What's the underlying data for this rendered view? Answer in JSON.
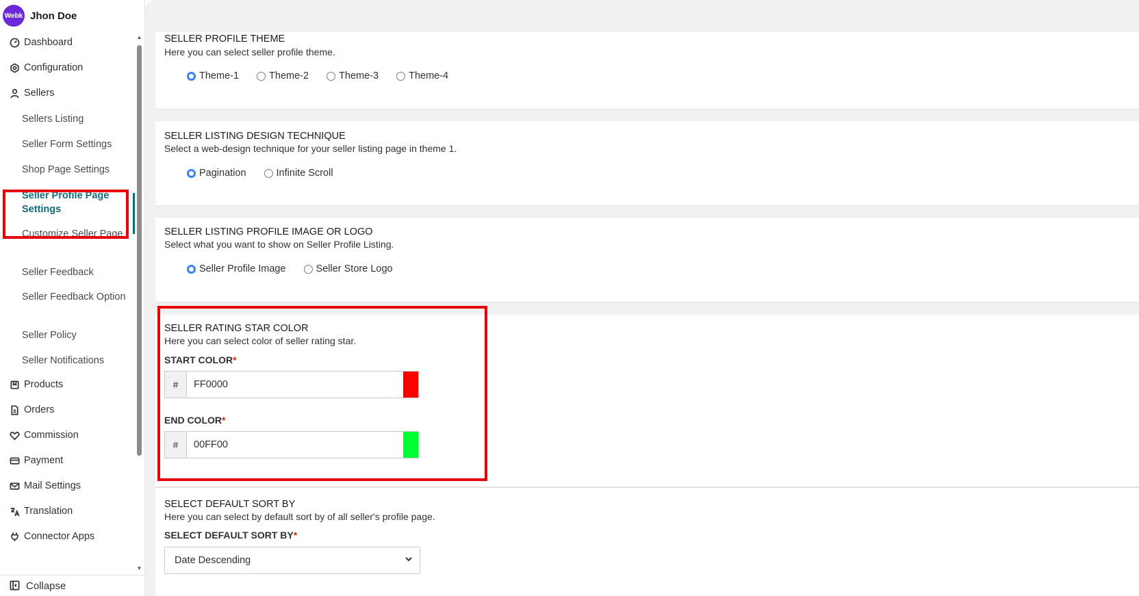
{
  "user": {
    "avatar_text": "Webk",
    "name": "Jhon Doe"
  },
  "sidebar": {
    "items": [
      {
        "label": "Dashboard",
        "icon": "dashboard-icon"
      },
      {
        "label": "Configuration",
        "icon": "gear-icon"
      },
      {
        "label": "Sellers",
        "icon": "person-icon"
      },
      {
        "label": "Products",
        "icon": "products-icon"
      },
      {
        "label": "Orders",
        "icon": "orders-icon"
      },
      {
        "label": "Commission",
        "icon": "commission-icon"
      },
      {
        "label": "Payment",
        "icon": "card-icon"
      },
      {
        "label": "Mail Settings",
        "icon": "mail-icon"
      },
      {
        "label": "Translation",
        "icon": "translate-icon"
      },
      {
        "label": "Connector Apps",
        "icon": "plug-icon"
      }
    ],
    "sellers_sub": [
      "Sellers Listing",
      "Seller Form Settings",
      "Shop Page Settings",
      "Seller Profile Page Settings",
      "Customize Seller Page",
      "Seller Feedback",
      "Seller Feedback Option",
      "Seller Policy",
      "Seller Notifications"
    ],
    "active_sub": "Seller Profile Page Settings",
    "collapse_label": "Collapse"
  },
  "sections": {
    "theme": {
      "title": "SELLER PROFILE THEME",
      "subtitle": "Here you can select seller profile theme.",
      "options": [
        "Theme-1",
        "Theme-2",
        "Theme-3",
        "Theme-4"
      ],
      "selected": "Theme-1"
    },
    "listing_design": {
      "title": "SELLER LISTING DESIGN TECHNIQUE",
      "subtitle": "Select a web-design technique for your seller listing page in theme 1.",
      "options": [
        "Pagination",
        "Infinite Scroll"
      ],
      "selected": "Pagination"
    },
    "profile_image": {
      "title": "SELLER LISTING PROFILE IMAGE OR LOGO",
      "subtitle": "Select what you want to show on Seller Profile Listing.",
      "options": [
        "Seller Profile Image",
        "Seller Store Logo"
      ],
      "selected": "Seller Profile Image"
    },
    "star_color": {
      "title": "SELLER RATING STAR COLOR",
      "subtitle": "Here you can select color of seller rating star.",
      "start_label": "START COLOR",
      "start_value": "FF0000",
      "start_swatch": "#ff0000",
      "end_label": "END COLOR",
      "end_value": "00FF00",
      "end_swatch": "#00ff33",
      "prefix": "#",
      "required_mark": "*"
    },
    "sort": {
      "title": "SELECT DEFAULT SORT BY",
      "subtitle": "Here you can select by default sort by of all seller's profile page.",
      "field_label": "SELECT DEFAULT SORT BY",
      "selected": "Date Descending"
    }
  },
  "colors": {
    "accent": "#116a7b",
    "highlight": "#e8000d",
    "radio": "#3b82f6"
  }
}
